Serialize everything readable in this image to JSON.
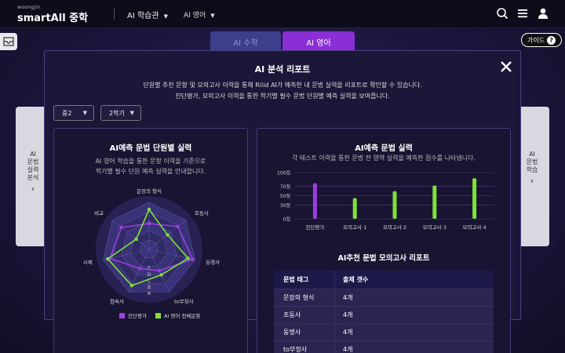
{
  "header": {
    "logo_small": "woongjin",
    "logo_main": "smartAll 중학",
    "nav": [
      {
        "label": "AI 학습관"
      },
      {
        "label": "AI 영어"
      }
    ]
  },
  "tabs": [
    {
      "label": "AI 수학",
      "active": false
    },
    {
      "label": "AI 영어",
      "active": true
    }
  ],
  "side": {
    "left": [
      "AI",
      "문법",
      "실력",
      "분석"
    ],
    "right": [
      "AI",
      "문법",
      "학습"
    ]
  },
  "guide_label": "가이드",
  "modal": {
    "title": "AI 분석 리포트",
    "desc1": "단원별 추천 문항 및 모의고사 이력을 통해 Riiid AI가 예측한 내 문법 실력을 리포트로 확인할 수 있습니다.",
    "desc2": "진단평가, 모의고사 이력을 통한 학기별 필수 문법 단원별 예측 실력을 보여줍니다.",
    "filters": {
      "grade": "중2",
      "semester": "2학기"
    }
  },
  "radar_panel": {
    "title": "AI예측 문법 단원별 실력",
    "sub1": "AI 영어 학습을 통한 문항 이력을 기준으로",
    "sub2": "학기별 필수 단원 예측 실력을 안내합니다.",
    "axes": [
      "문장의 형식",
      "조동사",
      "동명사",
      "to부정사",
      "접속사",
      "시제",
      "비교"
    ],
    "grades": [
      "E",
      "D",
      "C",
      "B",
      "A"
    ],
    "series": [
      {
        "name": "진단평가",
        "color": "#9b3fe0",
        "values": [
          0.55,
          0.78,
          0.95,
          0.5,
          0.45,
          0.85,
          0.75
        ]
      },
      {
        "name": "AI 영어 전체문항",
        "color": "#7ee23a",
        "values": [
          0.85,
          0.5,
          0.85,
          0.6,
          0.85,
          0.9,
          0.35
        ]
      }
    ]
  },
  "bar_panel": {
    "title": "AI예측 문법 실력",
    "sub": "각 테스트 이력을 통한 문법 전 영역 실력을 예측한 점수를 나타냅니다."
  },
  "chart_data": {
    "type": "bar",
    "categories": [
      "진단평가",
      "모의고사 1",
      "모의고사 2",
      "모의고사 3",
      "모의고사 4"
    ],
    "values": [
      77,
      45,
      60,
      72,
      88
    ],
    "colors": [
      "#9b3fe0",
      "#7ee23a",
      "#7ee23a",
      "#7ee23a",
      "#7ee23a"
    ],
    "yticks": [
      "0점",
      "30점",
      "50점",
      "70점",
      "100점"
    ],
    "ytick_values": [
      0,
      30,
      50,
      70,
      100
    ],
    "ylim": [
      0,
      100
    ],
    "grid": true
  },
  "table": {
    "title": "AI추천 문법 모의고사 리포트",
    "headers": [
      "문법 태그",
      "출제 갯수"
    ],
    "rows": [
      [
        "문장의 형식",
        "4개"
      ],
      [
        "조동사",
        "4개"
      ],
      [
        "동명사",
        "4개"
      ],
      [
        "to부정사",
        "4개"
      ]
    ]
  }
}
